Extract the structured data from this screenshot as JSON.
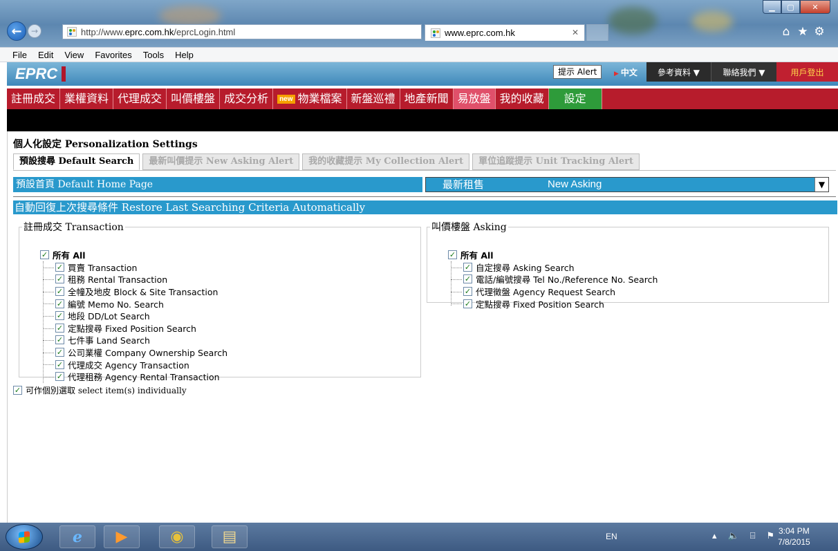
{
  "browser": {
    "url_prefix": "http://www.",
    "url_domain": "eprc.com.hk",
    "url_path": "/eprcLogin.html",
    "tab_title": "www.eprc.com.hk",
    "menu": [
      "File",
      "Edit",
      "View",
      "Favorites",
      "Tools",
      "Help"
    ]
  },
  "header": {
    "logo": "EPRC",
    "alert_button": "提示 Alert",
    "language_link": "中文",
    "reference_menu": "參考資料 ▼",
    "contact_menu": "聯絡我們 ▼",
    "logout_link": "用戶登出"
  },
  "nav": {
    "items": [
      "註冊成交",
      "業權資料",
      "代理成交",
      "叫價樓盤",
      "成交分析",
      "物業檔案",
      "新盤巡禮",
      "地產新聞",
      "易放盤",
      "我的收藏",
      "設定"
    ],
    "new_badge": "new"
  },
  "settings": {
    "page_title": "個人化設定 Personalization Settings",
    "tabs": [
      "預設搜尋 Default Search",
      "最新叫價提示 New Asking Alert",
      "我的收藏提示 My Collection Alert",
      "單位追蹤提示 Unit Tracking Alert"
    ],
    "default_home_label": "預設首頁 Default Home Page",
    "default_home_value_cn": "最新租售",
    "default_home_value_en": "New Asking",
    "restore_label": "自動回復上次搜尋條件 Restore Last Searching Criteria Automatically",
    "transaction_group": {
      "legend": "註冊成交 Transaction",
      "all_label": "所有 All",
      "items": [
        "買賣 Transaction",
        "租務 Rental Transaction",
        "全幢及地皮 Block & Site Transaction",
        "編號 Memo No. Search",
        "地段 DD/Lot Search",
        "定點搜尋 Fixed Position Search",
        "七件事 Land Search",
        "公司業權 Company Ownership Search",
        "代理成交 Agency Transaction",
        "代理租務 Agency Rental Transaction"
      ]
    },
    "asking_group": {
      "legend": "叫價樓盤 Asking",
      "all_label": "所有 All",
      "items": [
        "自定搜尋 Asking Search",
        "電話/編號搜尋 Tel No./Reference No. Search",
        "代理徵盤 Agency Request Search",
        "定點搜尋 Fixed Position Search"
      ]
    },
    "individual_label_cn": "可作個別選取",
    "individual_label_en": "select item(s) individually",
    "checkmark": "✓"
  },
  "taskbar": {
    "language": "EN",
    "time": "3:04 PM",
    "date": "7/8/2015"
  },
  "colors": {
    "nav_red": "#b71c2c",
    "header_blue": "#3e88ba",
    "bar_blue": "#2999cc"
  }
}
